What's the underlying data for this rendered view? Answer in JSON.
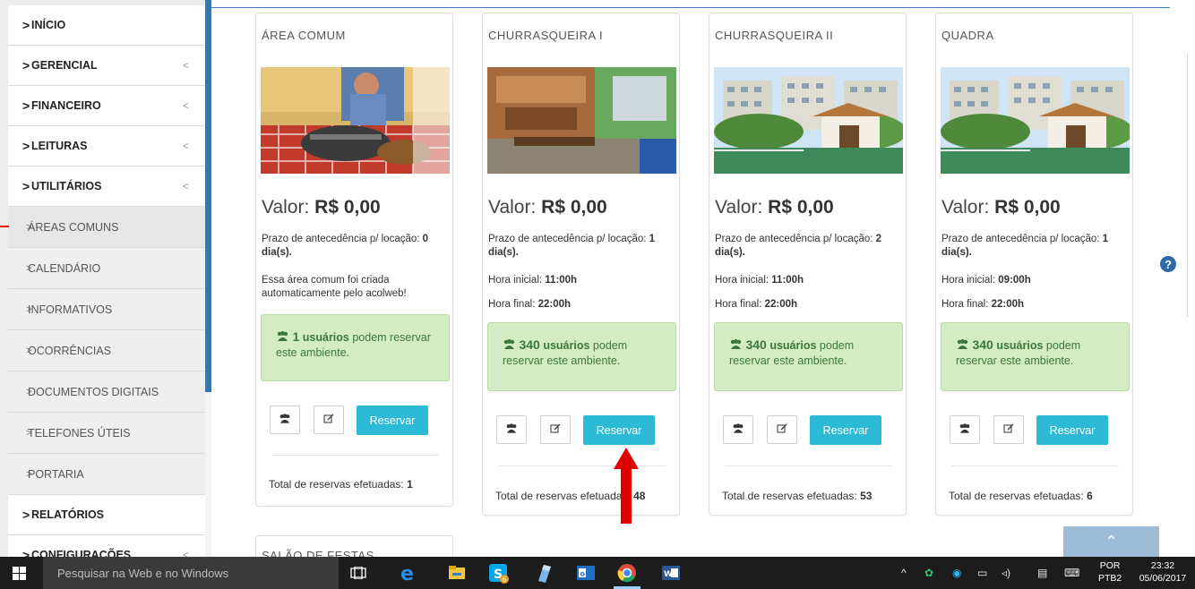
{
  "sidebar": {
    "items": [
      {
        "label": "INÍCIO",
        "type": "main",
        "has_arrow": false
      },
      {
        "label": "GERENCIAL",
        "type": "main",
        "has_arrow": true
      },
      {
        "label": "FINANCEIRO",
        "type": "main",
        "has_arrow": true
      },
      {
        "label": "LEITURAS",
        "type": "main",
        "has_arrow": true
      },
      {
        "label": "UTILITÁRIOS",
        "type": "main",
        "has_arrow": true
      },
      {
        "label": "ÁREAS COMUNS",
        "type": "sub"
      },
      {
        "label": "CALENDÁRIO",
        "type": "sub"
      },
      {
        "label": "INFORMATIVOS",
        "type": "sub"
      },
      {
        "label": "OCORRÊNCIAS",
        "type": "sub"
      },
      {
        "label": "DOCUMENTOS DIGITAIS",
        "type": "sub"
      },
      {
        "label": "TELEFONES ÚTEIS",
        "type": "sub"
      },
      {
        "label": "PORTARIA",
        "type": "sub"
      },
      {
        "label": "RELATÓRIOS",
        "type": "main",
        "has_arrow": false
      },
      {
        "label": "CONFIGURAÇÕES",
        "type": "main",
        "has_arrow": true
      }
    ],
    "chevron": ">",
    "collapse_arrow": "<"
  },
  "cards": [
    {
      "title": "ÁREA COMUM",
      "valor_label": "Valor:",
      "valor_value": "R$ 0,00",
      "prazo_text": "Prazo de antecedência p/ locação:",
      "prazo_value": "0",
      "prazo_unit": "dia(s).",
      "description": "Essa área comum foi criada automaticamente pelo acolweb!",
      "hora_inicial_label": "",
      "hora_inicial": "",
      "hora_final_label": "",
      "hora_final": "",
      "users_count": "1",
      "users_word": "usuários",
      "users_rest": "podem reservar este ambiente.",
      "reservar_label": "Reservar",
      "total_label": "Total de reservas efetuadas:",
      "total_value": "1"
    },
    {
      "title": "CHURRASQUEIRA I",
      "valor_label": "Valor:",
      "valor_value": "R$ 0,00",
      "prazo_text": "Prazo de antecedência p/ locação:",
      "prazo_value": "1",
      "prazo_unit": "dia(s).",
      "description": "",
      "hora_inicial_label": "Hora inicial:",
      "hora_inicial": "11:00h",
      "hora_final_label": "Hora final:",
      "hora_final": "22:00h",
      "users_count": "340",
      "users_word": "usuários",
      "users_rest": "podem reservar este ambiente.",
      "reservar_label": "Reservar",
      "total_label": "Total de reservas efetuadas:",
      "total_value": "48"
    },
    {
      "title": "CHURRASQUEIRA II",
      "valor_label": "Valor:",
      "valor_value": "R$ 0,00",
      "prazo_text": "Prazo de antecedência p/ locação:",
      "prazo_value": "2",
      "prazo_unit": "dia(s).",
      "description": "",
      "hora_inicial_label": "Hora inicial:",
      "hora_inicial": "11:00h",
      "hora_final_label": "Hora final:",
      "hora_final": "22:00h",
      "users_count": "340",
      "users_word": "usuários",
      "users_rest": "podem reservar este ambiente.",
      "reservar_label": "Reservar",
      "total_label": "Total de reservas efetuadas:",
      "total_value": "53"
    },
    {
      "title": "QUADRA",
      "valor_label": "Valor:",
      "valor_value": "R$ 0,00",
      "prazo_text": "Prazo de antecedência p/ locação:",
      "prazo_value": "1",
      "prazo_unit": "dia(s).",
      "description": "",
      "hora_inicial_label": "Hora inicial:",
      "hora_inicial": "09:00h",
      "hora_final_label": "Hora final:",
      "hora_final": "22:00h",
      "users_count": "340",
      "users_word": "usuários",
      "users_rest": "podem reservar este ambiente.",
      "reservar_label": "Reservar",
      "total_label": "Total de reservas efetuadas:",
      "total_value": "6"
    }
  ],
  "partial_card_title": "SALÃO DE FESTAS",
  "icons": {
    "users": "users-icon",
    "edit": "edit-icon",
    "help": "help-icon",
    "scroll_top": "chevron-up-icon"
  },
  "help_glyph": "?",
  "scroll_top_glyph": "⌃",
  "colors": {
    "sidebar_accent": "#2f79b5",
    "reservar_button": "#2cbad6",
    "note_bg": "#d4ecc3",
    "annotation_arrow": "#e10000"
  },
  "taskbar": {
    "search_placeholder": "Pesquisar na Web e no Windows",
    "language_top": "POR",
    "language_bottom": "PTB2",
    "time": "23:32",
    "date": "05/06/2017",
    "badge": "6"
  }
}
